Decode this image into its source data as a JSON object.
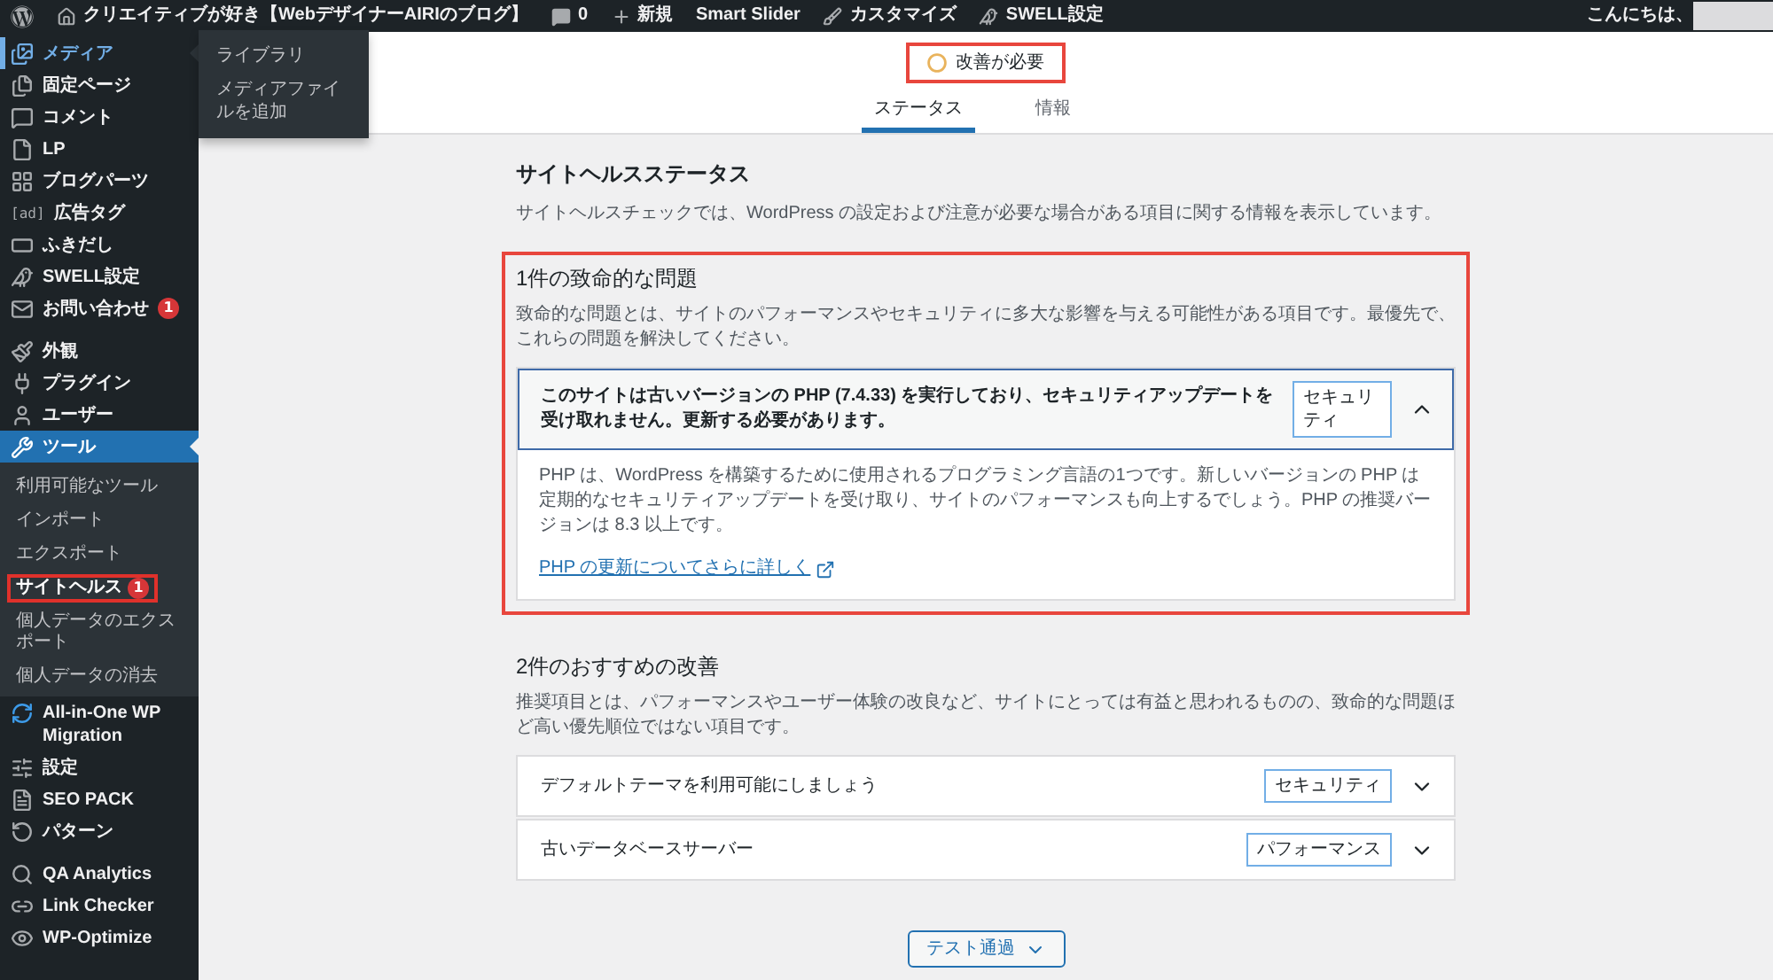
{
  "admin_bar": {
    "site_title": "クリエイティブが好き【WebデザイナーAIRIのブログ】",
    "links": [
      "0",
      "新規",
      "Smart Slider",
      "カスタマイズ",
      "SWELL設定"
    ],
    "greeting": "こんにちは、"
  },
  "sidebar": {
    "groups": [
      {
        "items": [
          {
            "label": "メディア",
            "selected": false,
            "hovered": true,
            "flyout": [
              "ライブラリ",
              "メディアファイルを追加"
            ]
          },
          {
            "label": "固定ページ",
            "selected": false,
            "hovered": false
          },
          {
            "label": "コメント",
            "selected": false,
            "hovered": false
          },
          {
            "label": "LP",
            "selected": false,
            "hovered": false
          },
          {
            "label": "ブログパーツ",
            "selected": false,
            "hovered": false
          },
          {
            "label": "広告タグ",
            "icon_text": "[ad]",
            "selected": false,
            "hovered": false
          },
          {
            "label": "ふきだし",
            "selected": false,
            "hovered": false
          },
          {
            "label": "SWELL設定",
            "selected": false,
            "hovered": false
          },
          {
            "label": "お問い合わせ",
            "badge": "1",
            "selected": false,
            "hovered": false
          }
        ]
      },
      {
        "items": [
          {
            "label": "外観",
            "selected": false,
            "hovered": false
          },
          {
            "label": "プラグイン",
            "selected": false,
            "hovered": false
          },
          {
            "label": "ユーザー",
            "selected": false,
            "hovered": false
          },
          {
            "label": "ツール",
            "selected": true,
            "hovered": false,
            "submenu": [
              {
                "label": "利用可能なツール",
                "selected": false,
                "highlighted": false
              },
              {
                "label": "インポート",
                "selected": false,
                "highlighted": false
              },
              {
                "label": "エクスポート",
                "selected": false,
                "highlighted": false
              },
              {
                "label": "サイトヘルス",
                "badge": "1",
                "selected": true,
                "highlighted": true
              },
              {
                "label": "個人データのエクスポート",
                "selected": false,
                "highlighted": false
              },
              {
                "label": "個人データの消去",
                "selected": false,
                "highlighted": false
              }
            ]
          },
          {
            "label": "All-in-One WP Migration",
            "selected": false,
            "hovered": false
          },
          {
            "label": "設定",
            "selected": false,
            "hovered": false
          },
          {
            "label": "SEO PACK",
            "selected": false,
            "hovered": false
          },
          {
            "label": "パターン",
            "selected": false,
            "hovered": false
          }
        ]
      },
      {
        "items": [
          {
            "label": "QA Analytics",
            "selected": false,
            "hovered": false
          },
          {
            "label": "Link Checker",
            "selected": false,
            "hovered": false
          },
          {
            "label": "WP-Optimize",
            "selected": false,
            "hovered": false
          }
        ]
      }
    ]
  },
  "header": {
    "status": {
      "label": "改善が必要",
      "highlighted": true
    },
    "tabs": [
      {
        "label": "ステータス",
        "selected": true
      },
      {
        "label": "情報",
        "selected": false
      }
    ]
  },
  "content": {
    "title": "サイトヘルスステータス",
    "description": "サイトヘルスチェックでは、WordPress の設定および注意が必要な場合がある項目に関する情報を表示しています。",
    "sections": [
      {
        "heading": "1件の致命的な問題",
        "description": "致命的な問題とは、サイトのパフォーマンスやセキュリティに多大な影響を与える可能性がある項目です。最優先で、これらの問題を解決してください。",
        "highlighted": true,
        "issues": [
          {
            "title": "このサイトは古いバージョンの PHP (7.4.33) を実行しており、セキュリティアップデートを受け取れません。更新する必要があります。",
            "badge": "セキュリティ",
            "expanded": true,
            "body": "PHP は、WordPress を構築するために使用されるプログラミング言語の1つです。新しいバージョンの PHP は定期的なセキュリティアップデートを受け取り、サイトのパフォーマンスも向上するでしょう。PHP の推奨バージョンは 8.3 以上です。",
            "link": "PHP の更新についてさらに詳しく"
          }
        ]
      },
      {
        "heading": "2件のおすすめの改善",
        "description": "推奨項目とは、パフォーマンスやユーザー体験の改良など、サイトにとっては有益と思われるものの、致命的な問題ほど高い優先順位ではない項目です。",
        "highlighted": false,
        "issues": [
          {
            "title": "デフォルトテーマを利用可能にしましょう",
            "badge": "セキュリティ",
            "expanded": false
          },
          {
            "title": "古いデータベースサーバー",
            "badge": "パフォーマンス",
            "expanded": false
          }
        ]
      }
    ],
    "passed_tests": {
      "label": "テスト通過",
      "expanded": false
    }
  }
}
